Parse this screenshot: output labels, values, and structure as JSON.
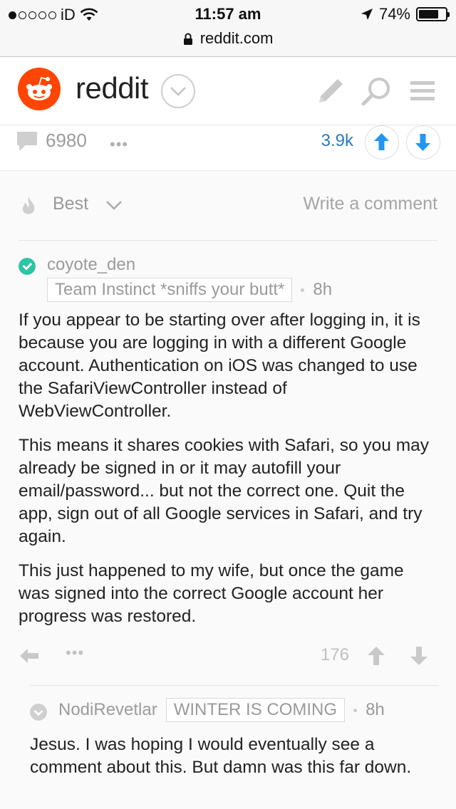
{
  "status_bar": {
    "carrier": "iD",
    "time": "11:57 am",
    "battery": "74%",
    "battery_level": 0.74
  },
  "browser": {
    "url": "reddit.com"
  },
  "header": {
    "wordmark": "reddit"
  },
  "post_actions": {
    "comment_count": "6980",
    "more": "•••",
    "score": "3.9k"
  },
  "sort_bar": {
    "sort_label": "Best",
    "write_comment": "Write a comment"
  },
  "comments": [
    {
      "author": "coyote_den",
      "flair": "Team Instinct *sniffs your butt*",
      "age": "8h",
      "paragraphs": [
        "If you appear to be starting over after logging in, it is because you are logging in with a different Google account. Authentication on iOS was changed to use the SafariViewController instead of WebViewController.",
        "This means it shares cookies with Safari, so you may already be signed in or it may autofill your email/password... but not the correct one. Quit the app, sign out of all Google services in Safari, and try again.",
        "This just happened to my wife, but once the game was signed into the correct Google account her progress was restored."
      ],
      "more": "•••",
      "score": "176"
    },
    {
      "author": "NodiRevetlar",
      "flair": "WINTER IS COMING",
      "age": "8h",
      "paragraphs": [
        "Jesus. I was hoping I would eventually see a comment about this. But damn was this far down."
      ]
    }
  ],
  "colors": {
    "reddit_orange": "#ff4500",
    "link_blue": "#2a7ac0",
    "upvote_blue": "#2196f3",
    "mod_check_teal": "#2ec4a6"
  }
}
